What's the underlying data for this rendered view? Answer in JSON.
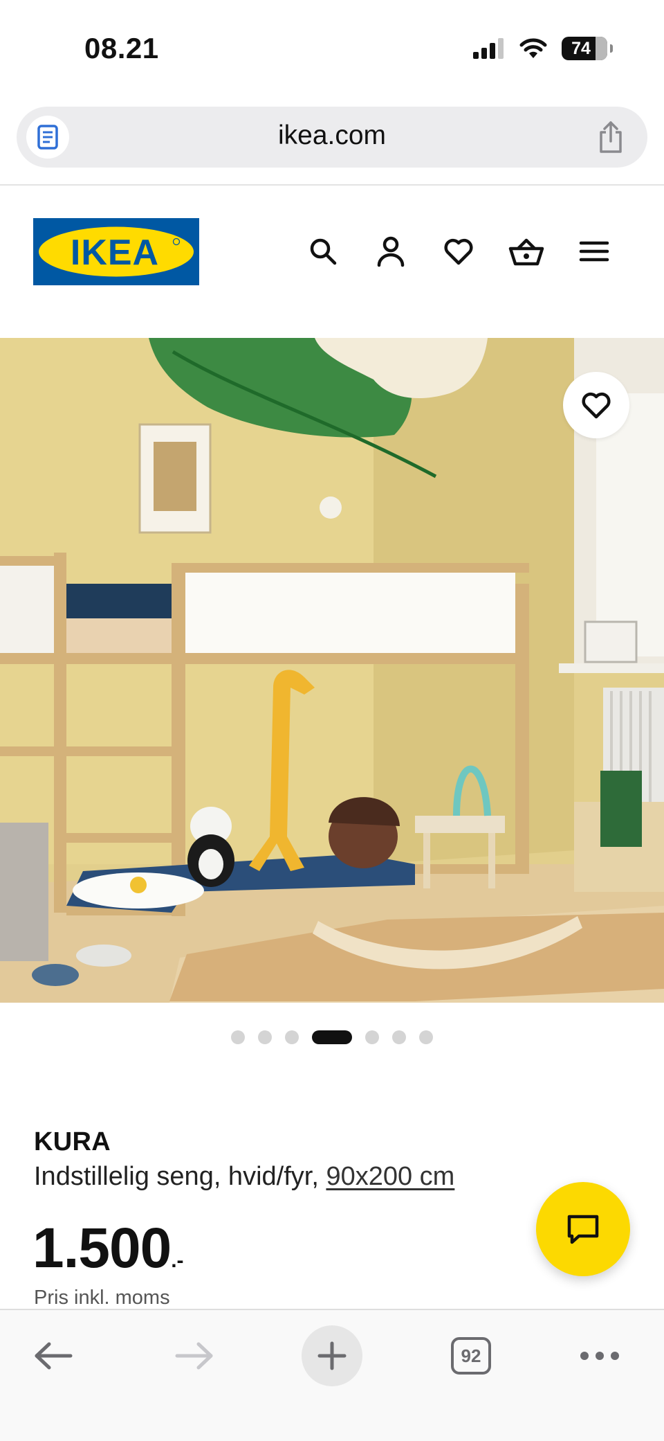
{
  "status_bar": {
    "time": "08.21",
    "battery": "74"
  },
  "browser": {
    "url": "ikea.com",
    "tab_count": "92"
  },
  "site_header": {
    "logo_text": "IKEA",
    "icons": [
      "search-icon",
      "account-icon",
      "heart-icon",
      "shopping-basket-icon",
      "menu-icon"
    ]
  },
  "gallery": {
    "image_count": 7,
    "active_index": 3,
    "favorite_icon": "heart-icon"
  },
  "product": {
    "name": "KURA",
    "description": "Indstillelig seng, hvid/fyr,",
    "size": "90x200 cm",
    "price": "1.500",
    "price_suffix": ".-",
    "price_note": "Pris inkl. moms"
  },
  "colors": {
    "ikea_blue": "#0058a3",
    "ikea_yellow": "#ffdb00",
    "chat_fab": "#fcd901"
  }
}
